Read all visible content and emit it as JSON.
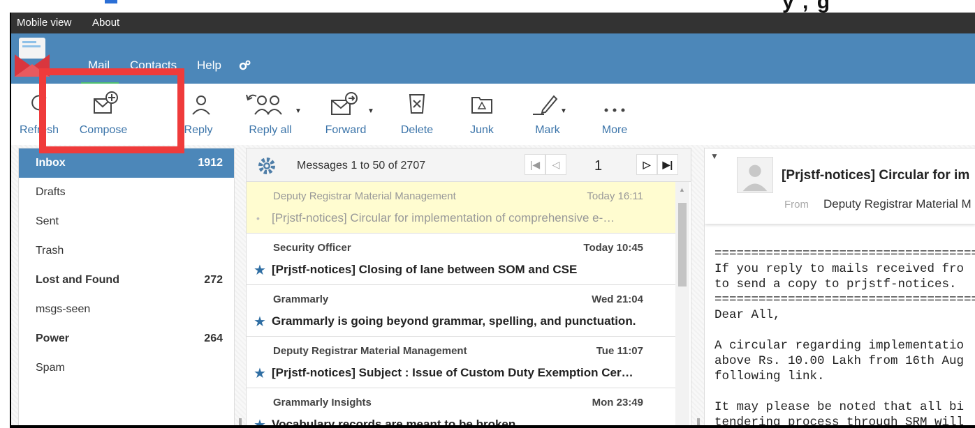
{
  "frame": {
    "top_glyphs": "y ,  g"
  },
  "topbar": {
    "mobile_view": "Mobile view",
    "about": "About"
  },
  "nav": {
    "mail": "Mail",
    "contacts": "Contacts",
    "help": "Help"
  },
  "toolbar": {
    "refresh": "Refresh",
    "compose": "Compose",
    "reply": "Reply",
    "reply_all": "Reply all",
    "forward": "Forward",
    "delete": "Delete",
    "junk": "Junk",
    "mark": "Mark",
    "more": "More"
  },
  "folders": [
    {
      "name": "Inbox",
      "count": "1912"
    },
    {
      "name": "Drafts",
      "count": ""
    },
    {
      "name": "Sent",
      "count": ""
    },
    {
      "name": "Trash",
      "count": ""
    },
    {
      "name": "Lost and Found",
      "count": "272"
    },
    {
      "name": "msgs-seen",
      "count": ""
    },
    {
      "name": "Power",
      "count": "264"
    },
    {
      "name": "Spam",
      "count": ""
    }
  ],
  "message_list": {
    "summary": "Messages 1 to 50 of 2707",
    "page": "1",
    "messages": [
      {
        "from": "Deputy Registrar Material Management",
        "date": "Today 16:11",
        "subject": "[Prjstf-notices] Circular for implementation of comprehensive e-…"
      },
      {
        "from": "Security Officer",
        "date": "Today 10:45",
        "subject": "[Prjstf-notices] Closing of lane between SOM and CSE"
      },
      {
        "from": "Grammarly",
        "date": "Wed 21:04",
        "subject": "Grammarly is going beyond grammar, spelling, and punctuation."
      },
      {
        "from": "Deputy Registrar Material Management",
        "date": "Tue 11:07",
        "subject": "[Prjstf-notices] Subject : Issue of Custom Duty Exemption Cer…"
      },
      {
        "from": "Grammarly Insights",
        "date": "Mon 23:49",
        "subject": "Vocabulary records are meant to be broken"
      }
    ]
  },
  "preview": {
    "subject": "[Prjstf-notices] Circular for im",
    "from_label": "From",
    "from": "Deputy Registrar Material M",
    "body": "=========================================\nIf you reply to mails received fro\nto send a copy to prjstf-notices.\n=========================================\nDear All,\n\nA circular regarding implementatio\nabove Rs. 10.00 Lakh from 16th Aug\nfollowing link.\n\nIt may please be noted that all bi\ntendering process through SRM will\nfor a procurement (Supplier Relati"
  },
  "colors": {
    "header_blue": "#4c87b9",
    "topbar_dark": "#333333",
    "link_blue": "#3b74a9",
    "highlight_red": "#ef3b3b",
    "selected_row": "#fffcd0",
    "star_blue": "#2f6ea3"
  },
  "icons": [
    "logo-icon",
    "settings-icon",
    "refresh-icon",
    "compose-icon",
    "reply-icon",
    "reply-all-icon",
    "forward-icon",
    "delete-icon",
    "junk-icon",
    "mark-icon",
    "more-icon",
    "gear-icon",
    "first-page-icon",
    "prev-page-icon",
    "next-page-icon",
    "last-page-icon",
    "star-icon",
    "avatar-icon"
  ]
}
